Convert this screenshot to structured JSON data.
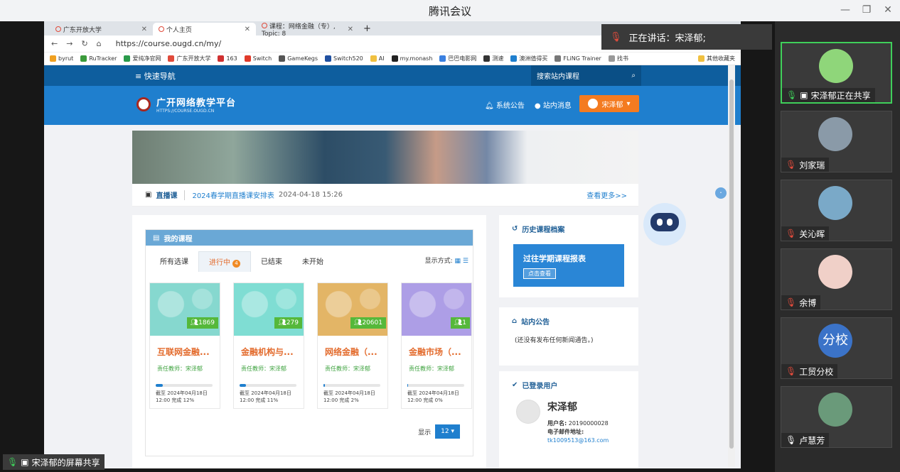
{
  "meeting": {
    "title": "腾讯会议",
    "speaking_label": "正在讲话：宋泽郁;",
    "share_label": "宋泽郁的屏幕共享",
    "participants": [
      {
        "name": "宋泽郁正在共享"
      },
      {
        "name": "刘家瑞"
      },
      {
        "name": "关沁晖"
      },
      {
        "name": "余博"
      },
      {
        "name": "工贸分校",
        "avatar_text": "分校"
      },
      {
        "name": "卢慧芳"
      }
    ]
  },
  "browser": {
    "tabs": [
      {
        "label": "广东开放大学"
      },
      {
        "label": "个人主页"
      },
      {
        "label": "课程：网络金融（专）, Topic: 8"
      }
    ],
    "url": "https://course.ougd.cn/my/",
    "bookmarks": [
      "byrut",
      "RuTracker",
      "爱纯净官网",
      "广东开放大学",
      "163",
      "Switch",
      "GameKegs",
      "Switch520",
      "AI",
      "my.monash",
      "巴巴电影网",
      "测速",
      "澳洲值得买",
      "FLiNG Trainer",
      "找书",
      "其他收藏夹"
    ]
  },
  "site": {
    "quick_nav": "≡ 快速导航",
    "search_placeholder": "搜索站内课程",
    "logo_name": "广开网络教学平台",
    "logo_sub": "HTTPS://COURSE.OUGD.CN",
    "system_notice": "系统公告",
    "messages": "站内消息",
    "user": "宋泽郁"
  },
  "live": {
    "label": "直播课",
    "link": "2024春学期直播课安排表",
    "date": "2024-04-18 15:26",
    "more": "查看更多>>"
  },
  "my_courses": {
    "title": "我的课程",
    "tabs": [
      "所有选课",
      "进行中",
      "已结束",
      "未开始"
    ],
    "in_progress_count": "4",
    "view_mode": "显示方式:",
    "courses": [
      {
        "name": "互联网金融...",
        "count": "1869",
        "teacher": "责任教师：宋泽郁",
        "deadline": "截至 2024年04月18日",
        "done": "12:00 完成 12%",
        "progress": 12,
        "color": "#86d8cf"
      },
      {
        "name": "金融机构与...",
        "count": "279",
        "teacher": "责任教师：宋泽郁",
        "deadline": "截至 2024年04月18日",
        "done": "12:00 完成 11%",
        "progress": 11,
        "color": "#7fddd3"
      },
      {
        "name": "网络金融（...",
        "count": "20601",
        "teacher": "责任教师：宋泽郁",
        "deadline": "截至 2024年04月18日",
        "done": "12:00 完成 2%",
        "progress": 2,
        "color": "#e3b566"
      },
      {
        "name": "金融市场（...",
        "count": "1",
        "teacher": "责任教师：宋泽郁",
        "deadline": "截至 2024年04月18日",
        "done": "12:00 完成 0%",
        "progress": 0,
        "color": "#ad9ee6"
      }
    ],
    "pager_label": "显示",
    "pager_value": "12 ▾"
  },
  "history": {
    "title": "历史课程档案",
    "banner": "过往学期课程报表",
    "button": "点击查看"
  },
  "notice": {
    "title": "站内公告",
    "text": "(还没有发布任何新闻通告。)"
  },
  "online": {
    "title": "已登录用户",
    "name": "宋泽郁",
    "username_label": "用户名:",
    "username": "20190000028",
    "email_label": "电子邮件地址:",
    "email": "tk1009513@163.com"
  },
  "colors": {
    "nav": "#0e5e9e",
    "header": "#1f7fce",
    "accent": "#f47b20",
    "speaking_green": "#3fcf5a"
  }
}
